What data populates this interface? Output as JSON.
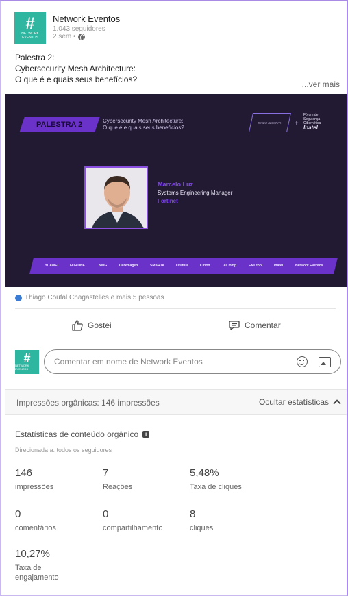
{
  "post": {
    "page_name": "Network Eventos",
    "followers": "1.043 seguidores",
    "time": "2 sem •",
    "logo_hash": "#",
    "logo_text": "NETWORK EVENTOS",
    "text_lines": [
      "Palestra 2:",
      "Cybersecurity Mesh Architecture:",
      "O que é e quais seus benefícios?"
    ],
    "see_more": "...ver mais"
  },
  "banner": {
    "tag": "PALESTRA 2",
    "title_line1": "Cybersecurity Mesh Architecture:",
    "title_line2": "O que é e quais seus benefícios?",
    "cyber_logo": "CYBER SECURITY",
    "plus": "+",
    "forum_line1": "Fórum de",
    "forum_line2": "Segurança",
    "forum_line3": "Cibernética",
    "forum_brand": "Inatel",
    "speaker_name": "Marcelo Luz",
    "speaker_role": "Systems Engineering Manager",
    "speaker_company": "Fortinet",
    "sponsors": [
      "HUAWEI",
      "FORTINET",
      "NWG",
      "Darkmagen",
      "SMARTA",
      "Ofuture",
      "Cirion",
      "TelComp",
      "EMCtool",
      "Inatel",
      "Network Eventos"
    ]
  },
  "reactions": {
    "text": "Thiago Coufal Chagastelles e mais 5 pessoas"
  },
  "actions": {
    "like": "Gostei",
    "comment": "Comentar"
  },
  "comment_input": {
    "placeholder": "Comentar em nome de Network Eventos"
  },
  "stats_bar": {
    "impressions": "Impressões orgânicas: 146 impressões",
    "hide": "Ocultar estatísticas"
  },
  "organic": {
    "title": "Estatísticas de conteúdo orgânico",
    "info": "i",
    "target": "Direcionada a: todos os seguidores",
    "stats": [
      {
        "value": "146",
        "label": "impressões"
      },
      {
        "value": "7",
        "label": "Reações"
      },
      {
        "value": "5,48%",
        "label": "Taxa de cliques"
      },
      {
        "value": "0",
        "label": "comentários"
      },
      {
        "value": "0",
        "label": "compartilhamento"
      },
      {
        "value": "8",
        "label": "cliques"
      },
      {
        "value": "10,27%",
        "label": "Taxa de engajamento"
      }
    ]
  }
}
